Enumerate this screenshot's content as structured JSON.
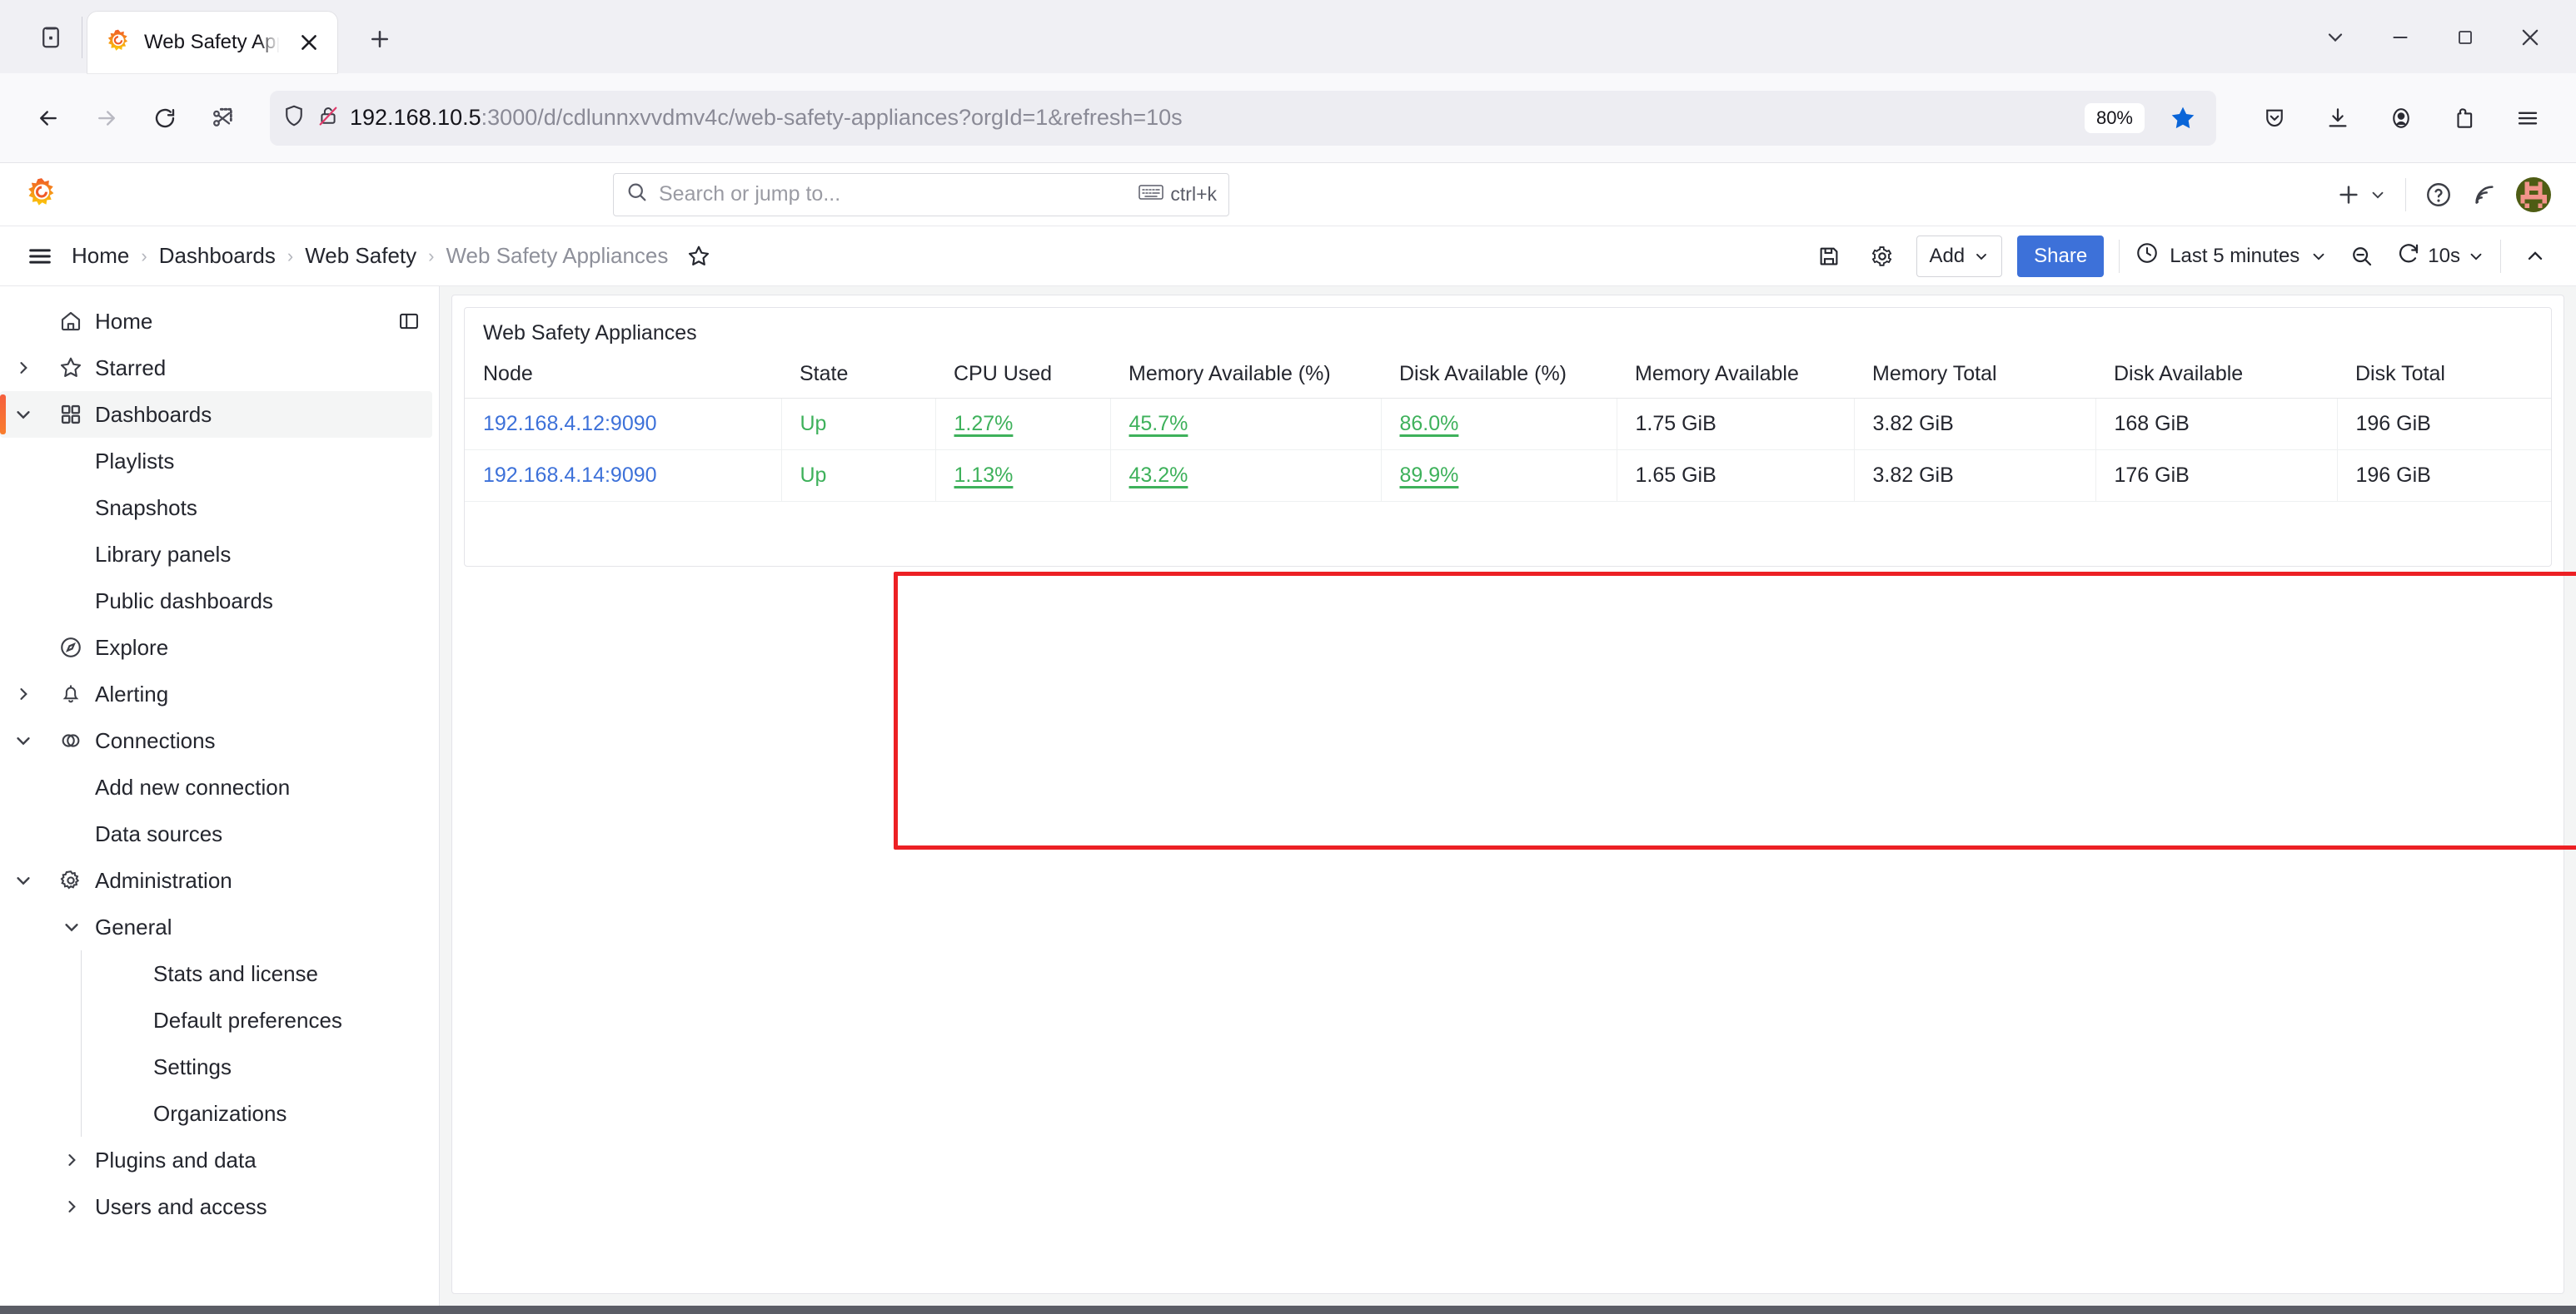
{
  "browser": {
    "tab": {
      "title": "Web Safety Appliances - Web Sa",
      "favicon": "grafana-logo-icon",
      "close": "close-icon"
    },
    "tab_list_button": "tab-list-icon",
    "new_tab_button": "new-tab-icon",
    "window_controls": {
      "minimize": "minimize-icon",
      "maximize": "maximize-icon",
      "close": "close-window-icon",
      "more": "chevron-down-icon"
    },
    "nav": {
      "back": "back-arrow-icon",
      "forward": "forward-arrow-icon",
      "reload": "reload-icon",
      "screenshot": "scissors-screenshot-icon"
    },
    "url": {
      "shield_icon": "tracking-protection-shield-icon",
      "lock_icon": "insecure-connection-icon",
      "host": "192.168.10.5",
      "path": ":3000/d/cdlunnxvvdmv4c/web-safety-appliances?orgId=1&refresh=10s",
      "full": "192.168.10.5:3000/d/cdlunnxvvdmv4c/web-safety-appliances?orgId=1&refresh=10s",
      "zoom_level": "80%",
      "bookmark_icon": "star-filled-icon"
    },
    "toolbar_right": [
      "pocket-save-icon",
      "downloads-icon",
      "account-icon",
      "extensions-icon",
      "app-menu-icon"
    ]
  },
  "grafana": {
    "logo": "grafana-logo-icon",
    "search": {
      "placeholder": "Search or jump to...",
      "icon": "search-icon",
      "shortcut": "ctrl+k",
      "kbd_icon": "keyboard-icon"
    },
    "topbar_right": {
      "add_icon": "plus-icon",
      "add_chevron": "chevron-down-icon",
      "help_icon": "question-circle-icon",
      "news_icon": "rss-news-icon",
      "avatar": "user-avatar"
    },
    "breadcrumbs": [
      {
        "label": "Home",
        "current": false
      },
      {
        "label": "Dashboards",
        "current": false
      },
      {
        "label": "Web Safety",
        "current": false
      },
      {
        "label": "Web Safety Appliances",
        "current": true
      }
    ],
    "menu_toggle_icon": "hamburger-menu-icon",
    "favorite_icon": "star-outline-icon",
    "toolbar": {
      "save_icon": "save-dashboard-icon",
      "settings_icon": "dashboard-settings-icon",
      "add_label": "Add",
      "add_chevron": "chevron-down-icon",
      "share_label": "Share",
      "time_icon": "clock-icon",
      "time_range": "Last 5 minutes",
      "time_chevron": "chevron-down-icon",
      "zoom_out_icon": "zoom-out-icon",
      "refresh_icon": "refresh-icon",
      "refresh_interval": "10s",
      "refresh_chevron": "chevron-down-icon",
      "collapse_icon": "chevron-up-icon"
    },
    "sidebar": {
      "dock_icon": "dock-menu-icon",
      "items": [
        {
          "label": "Home",
          "icon": "home-icon",
          "chevron": "none",
          "level": 0,
          "active": false
        },
        {
          "label": "Starred",
          "icon": "star-outline-icon",
          "chevron": "right",
          "level": 0,
          "active": false
        },
        {
          "label": "Dashboards",
          "icon": "dashboards-grid-icon",
          "chevron": "down",
          "level": 0,
          "active": true
        },
        {
          "label": "Playlists",
          "icon": "none",
          "chevron": "none",
          "level": 1,
          "active": false
        },
        {
          "label": "Snapshots",
          "icon": "none",
          "chevron": "none",
          "level": 1,
          "active": false
        },
        {
          "label": "Library panels",
          "icon": "none",
          "chevron": "none",
          "level": 1,
          "active": false
        },
        {
          "label": "Public dashboards",
          "icon": "none",
          "chevron": "none",
          "level": 1,
          "active": false
        },
        {
          "label": "Explore",
          "icon": "compass-icon",
          "chevron": "none",
          "level": 0,
          "active": false
        },
        {
          "label": "Alerting",
          "icon": "bell-icon",
          "chevron": "right",
          "level": 0,
          "active": false
        },
        {
          "label": "Connections",
          "icon": "connections-icon",
          "chevron": "down",
          "level": 0,
          "active": false
        },
        {
          "label": "Add new connection",
          "icon": "none",
          "chevron": "none",
          "level": 1,
          "active": false
        },
        {
          "label": "Data sources",
          "icon": "none",
          "chevron": "none",
          "level": 1,
          "active": false
        },
        {
          "label": "Administration",
          "icon": "gear-icon",
          "chevron": "down",
          "level": 0,
          "active": false
        },
        {
          "label": "General",
          "icon": "none",
          "chevron": "down",
          "level": 1,
          "active": false
        },
        {
          "label": "Stats and license",
          "icon": "none",
          "chevron": "none",
          "level": 2,
          "active": false
        },
        {
          "label": "Default preferences",
          "icon": "none",
          "chevron": "none",
          "level": 2,
          "active": false
        },
        {
          "label": "Settings",
          "icon": "none",
          "chevron": "none",
          "level": 2,
          "active": false
        },
        {
          "label": "Organizations",
          "icon": "none",
          "chevron": "none",
          "level": 2,
          "active": false
        },
        {
          "label": "Plugins and data",
          "icon": "none",
          "chevron": "right",
          "level": 1,
          "active": false
        },
        {
          "label": "Users and access",
          "icon": "none",
          "chevron": "right",
          "level": 1,
          "active": false
        }
      ]
    },
    "panel": {
      "title": "Web Safety Appliances",
      "highlighted": true,
      "highlight_color": "#ec2024",
      "columns": [
        "Node",
        "State",
        "CPU Used",
        "Memory Available (%)",
        "Disk Available (%)",
        "Memory Available",
        "Memory Total",
        "Disk Available",
        "Disk Total"
      ],
      "rows": [
        {
          "node": "192.168.4.12:9090",
          "state": "Up",
          "cpu_used": "1.27%",
          "memory_available_pct": "45.7%",
          "disk_available_pct": "86.0%",
          "memory_available": "1.75 GiB",
          "memory_total": "3.82 GiB",
          "disk_available": "168 GiB",
          "disk_total": "196 GiB"
        },
        {
          "node": "192.168.4.14:9090",
          "state": "Up",
          "cpu_used": "1.13%",
          "memory_available_pct": "43.2%",
          "disk_available_pct": "89.9%",
          "memory_available": "1.65 GiB",
          "memory_total": "3.82 GiB",
          "disk_available": "176 GiB",
          "disk_total": "196 GiB"
        }
      ]
    },
    "colors": {
      "link_blue": "#3d71d9",
      "status_green": "#3eb15b",
      "accent_orange": "#f55f3e",
      "primary_button": "#3d71d9"
    }
  }
}
